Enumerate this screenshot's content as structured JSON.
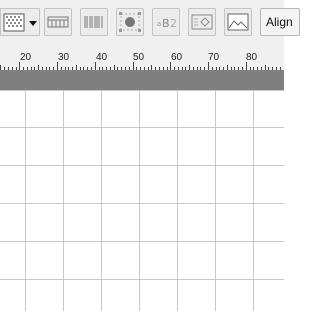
{
  "toolbar": {
    "align_label": "Align",
    "buttons": [
      {
        "name": "texture-icon"
      },
      {
        "name": "table-icon"
      },
      {
        "name": "barcode-icon"
      },
      {
        "name": "circle-shape-icon"
      },
      {
        "name": "rich-text-icon"
      },
      {
        "name": "image-frame-icon"
      },
      {
        "name": "picture-icon"
      }
    ]
  },
  "ruler": {
    "labels": [
      "20",
      "30",
      "40",
      "50",
      "60",
      "70",
      "80"
    ]
  }
}
